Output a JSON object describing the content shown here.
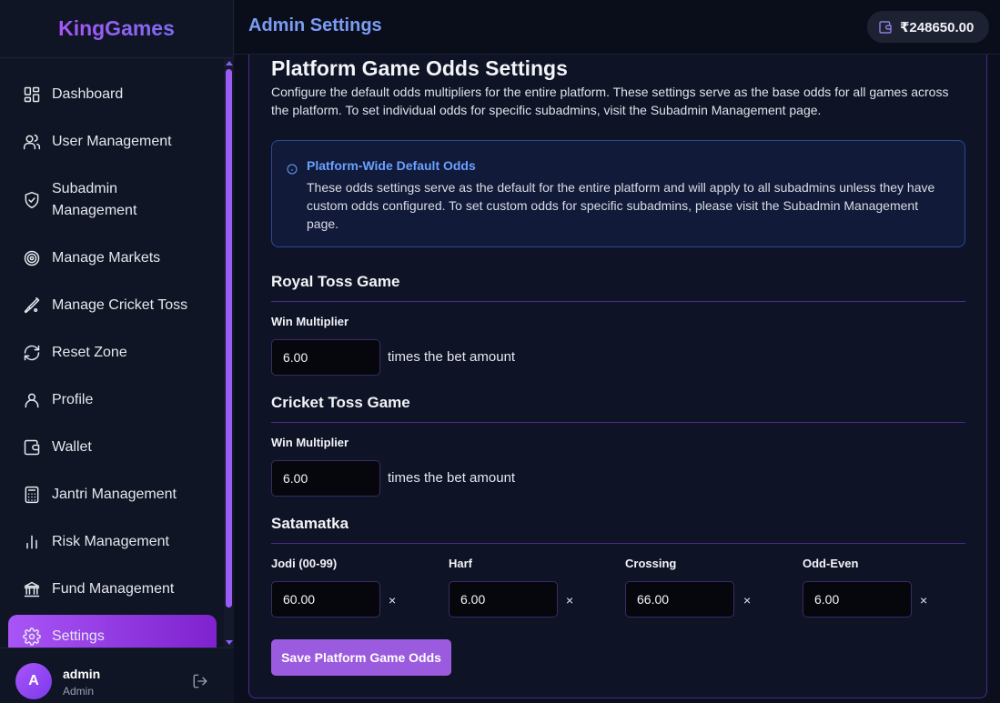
{
  "brand": {
    "name": "KingGames"
  },
  "header": {
    "title": "Admin Settings",
    "balance": "₹248650.00"
  },
  "sidebar": {
    "items": [
      {
        "label": "Dashboard",
        "icon": "dashboard-icon"
      },
      {
        "label": "User Management",
        "icon": "users-icon"
      },
      {
        "label": "Subadmin\nManagement",
        "icon": "shield-check-icon"
      },
      {
        "label": "Manage Markets",
        "icon": "target-icon"
      },
      {
        "label": "Manage Cricket Toss",
        "icon": "cricket-bat-icon"
      },
      {
        "label": "Reset Zone",
        "icon": "refresh-icon"
      },
      {
        "label": "Profile",
        "icon": "user-icon"
      },
      {
        "label": "Wallet",
        "icon": "wallet-icon"
      },
      {
        "label": "Jantri Management",
        "icon": "calculator-icon"
      },
      {
        "label": "Risk Management",
        "icon": "bar-chart-icon"
      },
      {
        "label": "Fund Management",
        "icon": "bank-icon"
      },
      {
        "label": "Settings",
        "icon": "gear-icon",
        "active": true
      }
    ],
    "user": {
      "initial": "A",
      "name": "admin",
      "role": "Admin"
    }
  },
  "main": {
    "title": "Platform Game Odds Settings",
    "description": "Configure the default odds multipliers for the entire platform. These settings serve as the base odds for all games across the platform. To set individual odds for specific subadmins, visit the Subadmin Management page.",
    "info": {
      "title": "Platform-Wide Default Odds",
      "text": "These odds settings serve as the default for the entire platform and will apply to all subadmins unless they have custom odds configured. To set custom odds for specific subadmins, please visit the Subadmin Management page."
    },
    "royal_toss": {
      "title": "Royal Toss Game",
      "label": "Win Multiplier",
      "value": "6.00",
      "suffix": "times the bet amount"
    },
    "cricket_toss": {
      "title": "Cricket Toss Game",
      "label": "Win Multiplier",
      "value": "6.00",
      "suffix": "times the bet amount"
    },
    "satamatka": {
      "title": "Satamatka",
      "fields": [
        {
          "label": "Jodi (00-99)",
          "value": "60.00",
          "suffix": "×"
        },
        {
          "label": "Harf",
          "value": "6.00",
          "suffix": "×"
        },
        {
          "label": "Crossing",
          "value": "66.00",
          "suffix": "×"
        },
        {
          "label": "Odd-Even",
          "value": "6.00",
          "suffix": "×"
        }
      ]
    },
    "save_label": "Save Platform Game Odds"
  },
  "colors": {
    "accent": "#a855f7",
    "title_blue": "#7b9cf5",
    "info_blue": "#6aa0ff",
    "border_purple": "#4c2a86"
  }
}
